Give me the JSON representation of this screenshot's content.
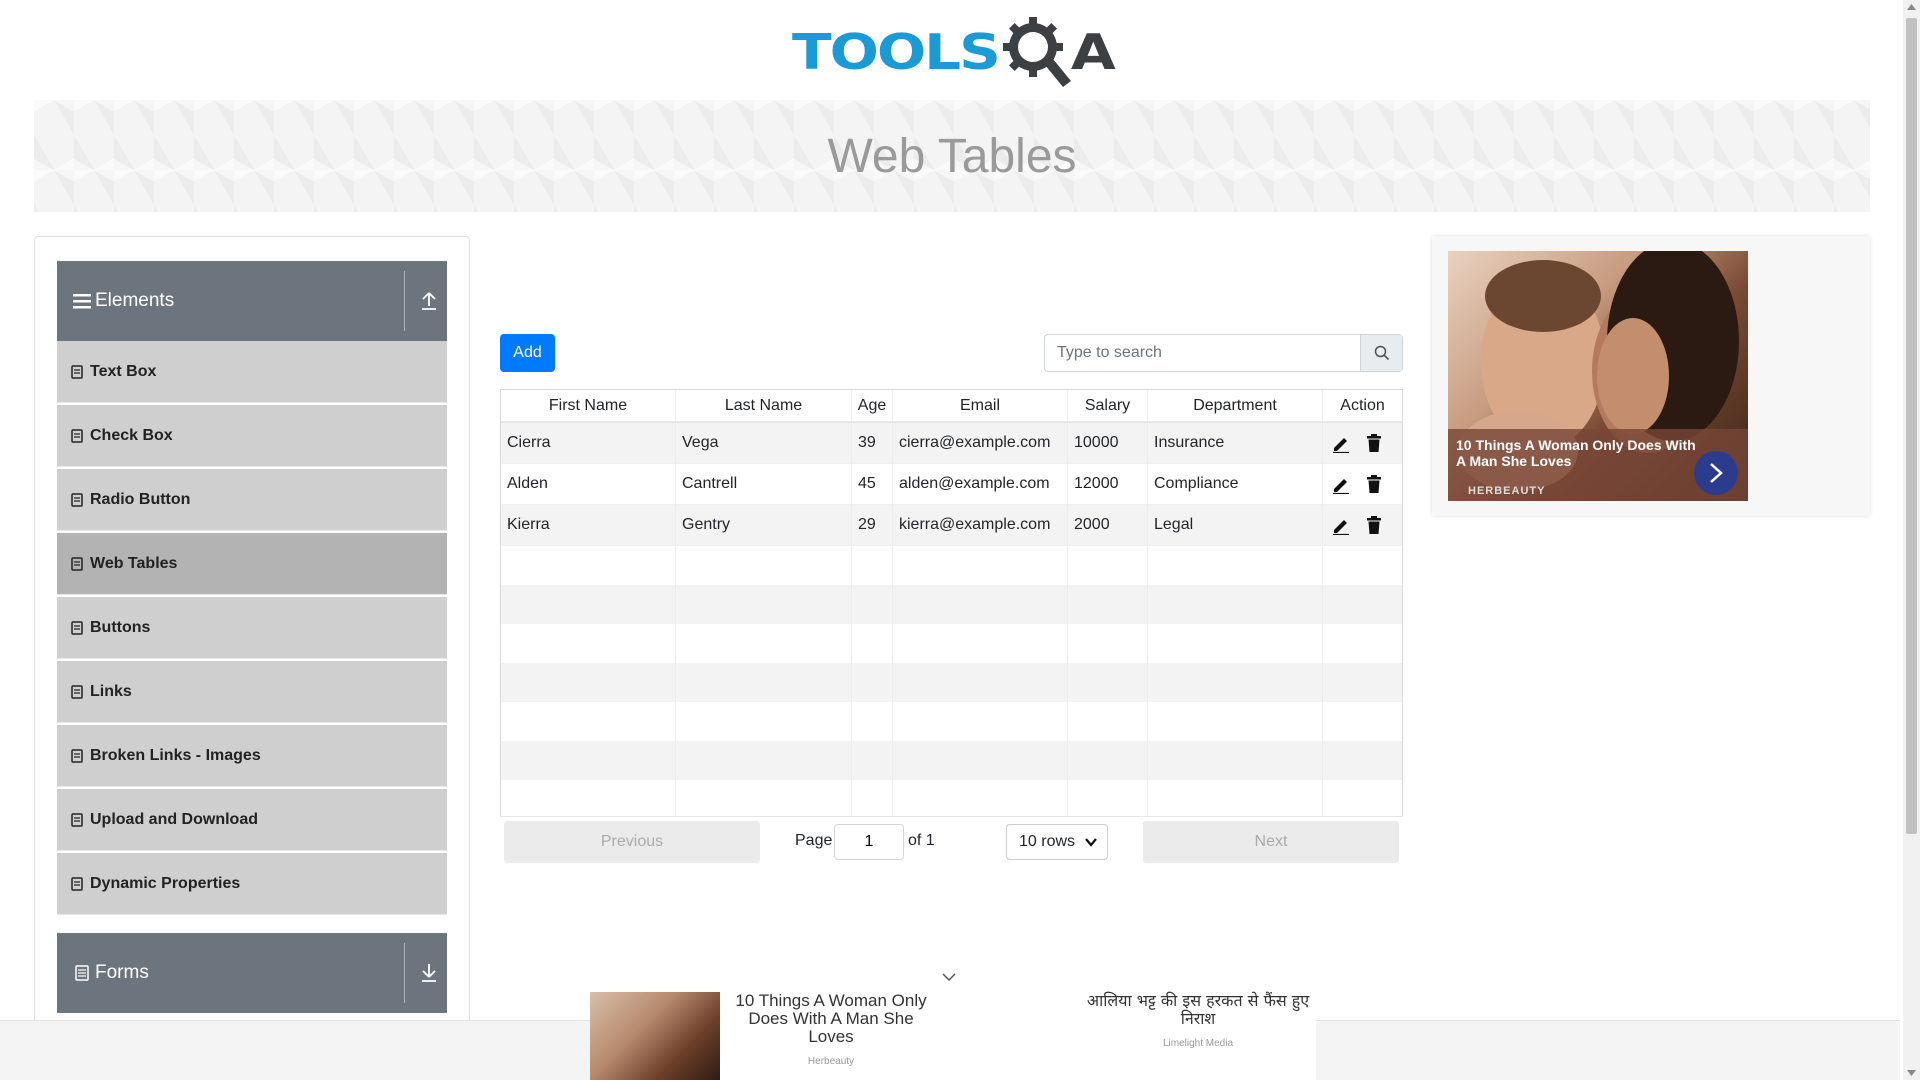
{
  "logo": {
    "text_tools": "TOOLS",
    "text_a": "A"
  },
  "banner": {
    "title": "Web Tables"
  },
  "sidebar": {
    "groups": [
      {
        "title": "Elements",
        "icon": "hamburger-icon"
      },
      {
        "title": "Forms",
        "icon": "form-icon"
      }
    ],
    "items": [
      {
        "label": "Text Box"
      },
      {
        "label": "Check Box"
      },
      {
        "label": "Radio Button"
      },
      {
        "label": "Web Tables"
      },
      {
        "label": "Buttons"
      },
      {
        "label": "Links"
      },
      {
        "label": "Broken Links - Images"
      },
      {
        "label": "Upload and Download"
      },
      {
        "label": "Dynamic Properties"
      }
    ],
    "active_item": "Web Tables"
  },
  "toolbar": {
    "add_label": "Add",
    "search_placeholder": "Type to search"
  },
  "table": {
    "headers": [
      "First Name",
      "Last Name",
      "Age",
      "Email",
      "Salary",
      "Department",
      "Action"
    ],
    "rows": [
      {
        "first": "Cierra",
        "last": "Vega",
        "age": "39",
        "email": "cierra@example.com",
        "salary": "10000",
        "dept": "Insurance"
      },
      {
        "first": "Alden",
        "last": "Cantrell",
        "age": "45",
        "email": "alden@example.com",
        "salary": "12000",
        "dept": "Compliance"
      },
      {
        "first": "Kierra",
        "last": "Gentry",
        "age": "29",
        "email": "kierra@example.com",
        "salary": "2000",
        "dept": "Legal"
      }
    ]
  },
  "pagination": {
    "previous_label": "Previous",
    "next_label": "Next",
    "page_label": "Page",
    "page_value": "1",
    "of_label": "of 1",
    "rows_label": "10 rows"
  },
  "right_ad": {
    "title": "10 Things A Woman Only Does With A Man She Loves",
    "brand": "HERBEAUTY"
  },
  "bottom_ad": {
    "left_title": "10 Things A Woman Only Does With A Man She Loves",
    "left_brand": "Herbeauty",
    "right_title": "आलिया भट्ट की इस हरकत से फैंस हुए निराश",
    "right_brand": "Limelight Media"
  },
  "colors": {
    "primary": "#007bff",
    "sidebar_header": "#6c757d",
    "menu_item": "#cfcfcf",
    "menu_active": "#b3b3b3",
    "logo_blue": "#1a9ad6"
  }
}
